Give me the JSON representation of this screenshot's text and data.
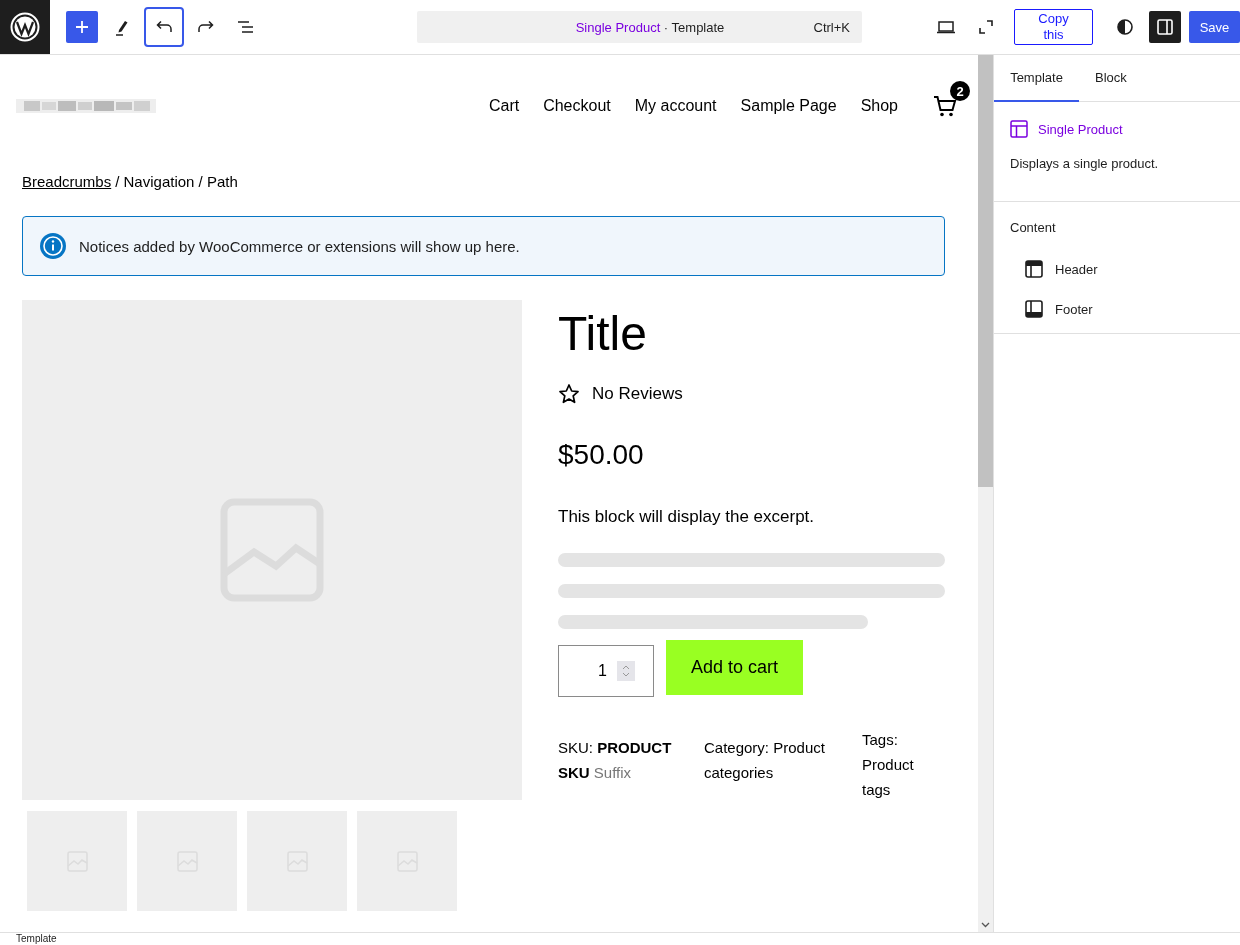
{
  "topbar": {
    "left_tools": [
      {
        "kind": "add",
        "focused": false
      },
      {
        "kind": "edit",
        "focused": false
      },
      {
        "kind": "undo",
        "focused": true
      },
      {
        "kind": "redo",
        "focused": false
      },
      {
        "kind": "list",
        "focused": false
      }
    ],
    "command": {
      "title": "Single Product",
      "suffix": "· Template",
      "shortcut": "Ctrl+K"
    },
    "view_tools": [
      {
        "kind": "view",
        "pressed": false
      },
      {
        "kind": "fullscreen",
        "pressed": false
      }
    ],
    "copy_button": "Copy this",
    "panel_tools": [
      {
        "kind": "styles",
        "pressed": false
      },
      {
        "kind": "settings",
        "pressed": true
      }
    ],
    "save_button": "Save"
  },
  "site": {
    "nav": [
      "Cart",
      "Checkout",
      "My account",
      "Sample Page",
      "Shop"
    ],
    "cart_count": "2"
  },
  "breadcrumbs": {
    "link": "Breadcrumbs",
    "rest": "/ Navigation / Path"
  },
  "notice": "Notices added by WooCommerce or extensions will show up here.",
  "product": {
    "title": "Title",
    "reviews": "No Reviews",
    "price": "$50.00",
    "excerpt": "This block will display the excerpt.",
    "quantity": "1",
    "add_to_cart": "Add to cart",
    "sku": {
      "label": "SKU:",
      "value": "PRODUCT SKU",
      "suffix": "Suffix"
    },
    "category": "Category: Product categories",
    "tags": "Tags: Product tags"
  },
  "sidebar": {
    "tabs": [
      {
        "label": "Template",
        "selected": true
      },
      {
        "label": "Block",
        "selected": false
      }
    ],
    "template": {
      "title": "Single Product",
      "description": "Displays a single product."
    },
    "content_heading": "Content",
    "content_items": [
      {
        "kind": "header",
        "label": "Header"
      },
      {
        "kind": "footer",
        "label": "Footer"
      }
    ]
  },
  "status_bar": "Template"
}
